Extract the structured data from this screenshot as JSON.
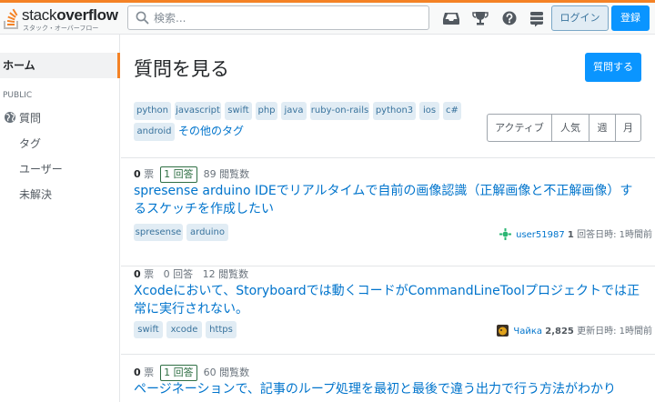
{
  "header": {
    "logo_text_light": "stack",
    "logo_text_bold": "overflow",
    "logo_sub": "スタック・オーバーフロー",
    "search_placeholder": "検索...",
    "login_label": "ログイン",
    "signup_label": "登録"
  },
  "sidebar": {
    "home": "ホーム",
    "public": "PUBLIC",
    "questions": "質問",
    "tags": "タグ",
    "users": "ユーザー",
    "unanswered": "未解決"
  },
  "main": {
    "title": "質問を見る",
    "ask_label": "質問する",
    "tags": [
      "python",
      "javascript",
      "swift",
      "php",
      "java",
      "ruby-on-rails",
      "python3",
      "ios",
      "c#",
      "android"
    ],
    "more_tags": "その他のタグ",
    "filters": [
      "アクティブ",
      "人気",
      "週",
      "月"
    ]
  },
  "questions": [
    {
      "votes": "0",
      "votes_label": "票",
      "answers": "1",
      "answers_label": "回答",
      "views": "89",
      "views_label": "閲覧数",
      "title": "spresense arduino IDEでリアルタイムで自前の画像認識（正解画像と不正解画像）するスケッチを作成したい",
      "tags": [
        "spresense",
        "arduino"
      ],
      "user": "user51987",
      "rep": "1",
      "time": "回答日時: 1時間前"
    },
    {
      "votes": "0",
      "votes_label": "票",
      "answers": "0",
      "answers_label": "回答",
      "views": "12",
      "views_label": "閲覧数",
      "title": "Xcodeにおいて、Storyboardでは動くコードがCommandLineToolプロジェクトでは正常に実行されない。",
      "tags": [
        "swift",
        "xcode",
        "https"
      ],
      "user": "Чайка",
      "rep": "2,825",
      "time": "更新日時: 1時間前"
    },
    {
      "votes": "0",
      "votes_label": "票",
      "answers": "1",
      "answers_label": "回答",
      "views": "60",
      "views_label": "閲覧数",
      "title": "ページネーションで、記事のループ処理を最初と最後で違う出力で行う方法がわかり"
    }
  ],
  "colors": {
    "accent": "#f48225",
    "link": "#0074cc",
    "primary": "#0a95ff",
    "tag_bg": "#e1ecf4",
    "tag_text": "#39739d",
    "answered": "#2f6f44"
  }
}
